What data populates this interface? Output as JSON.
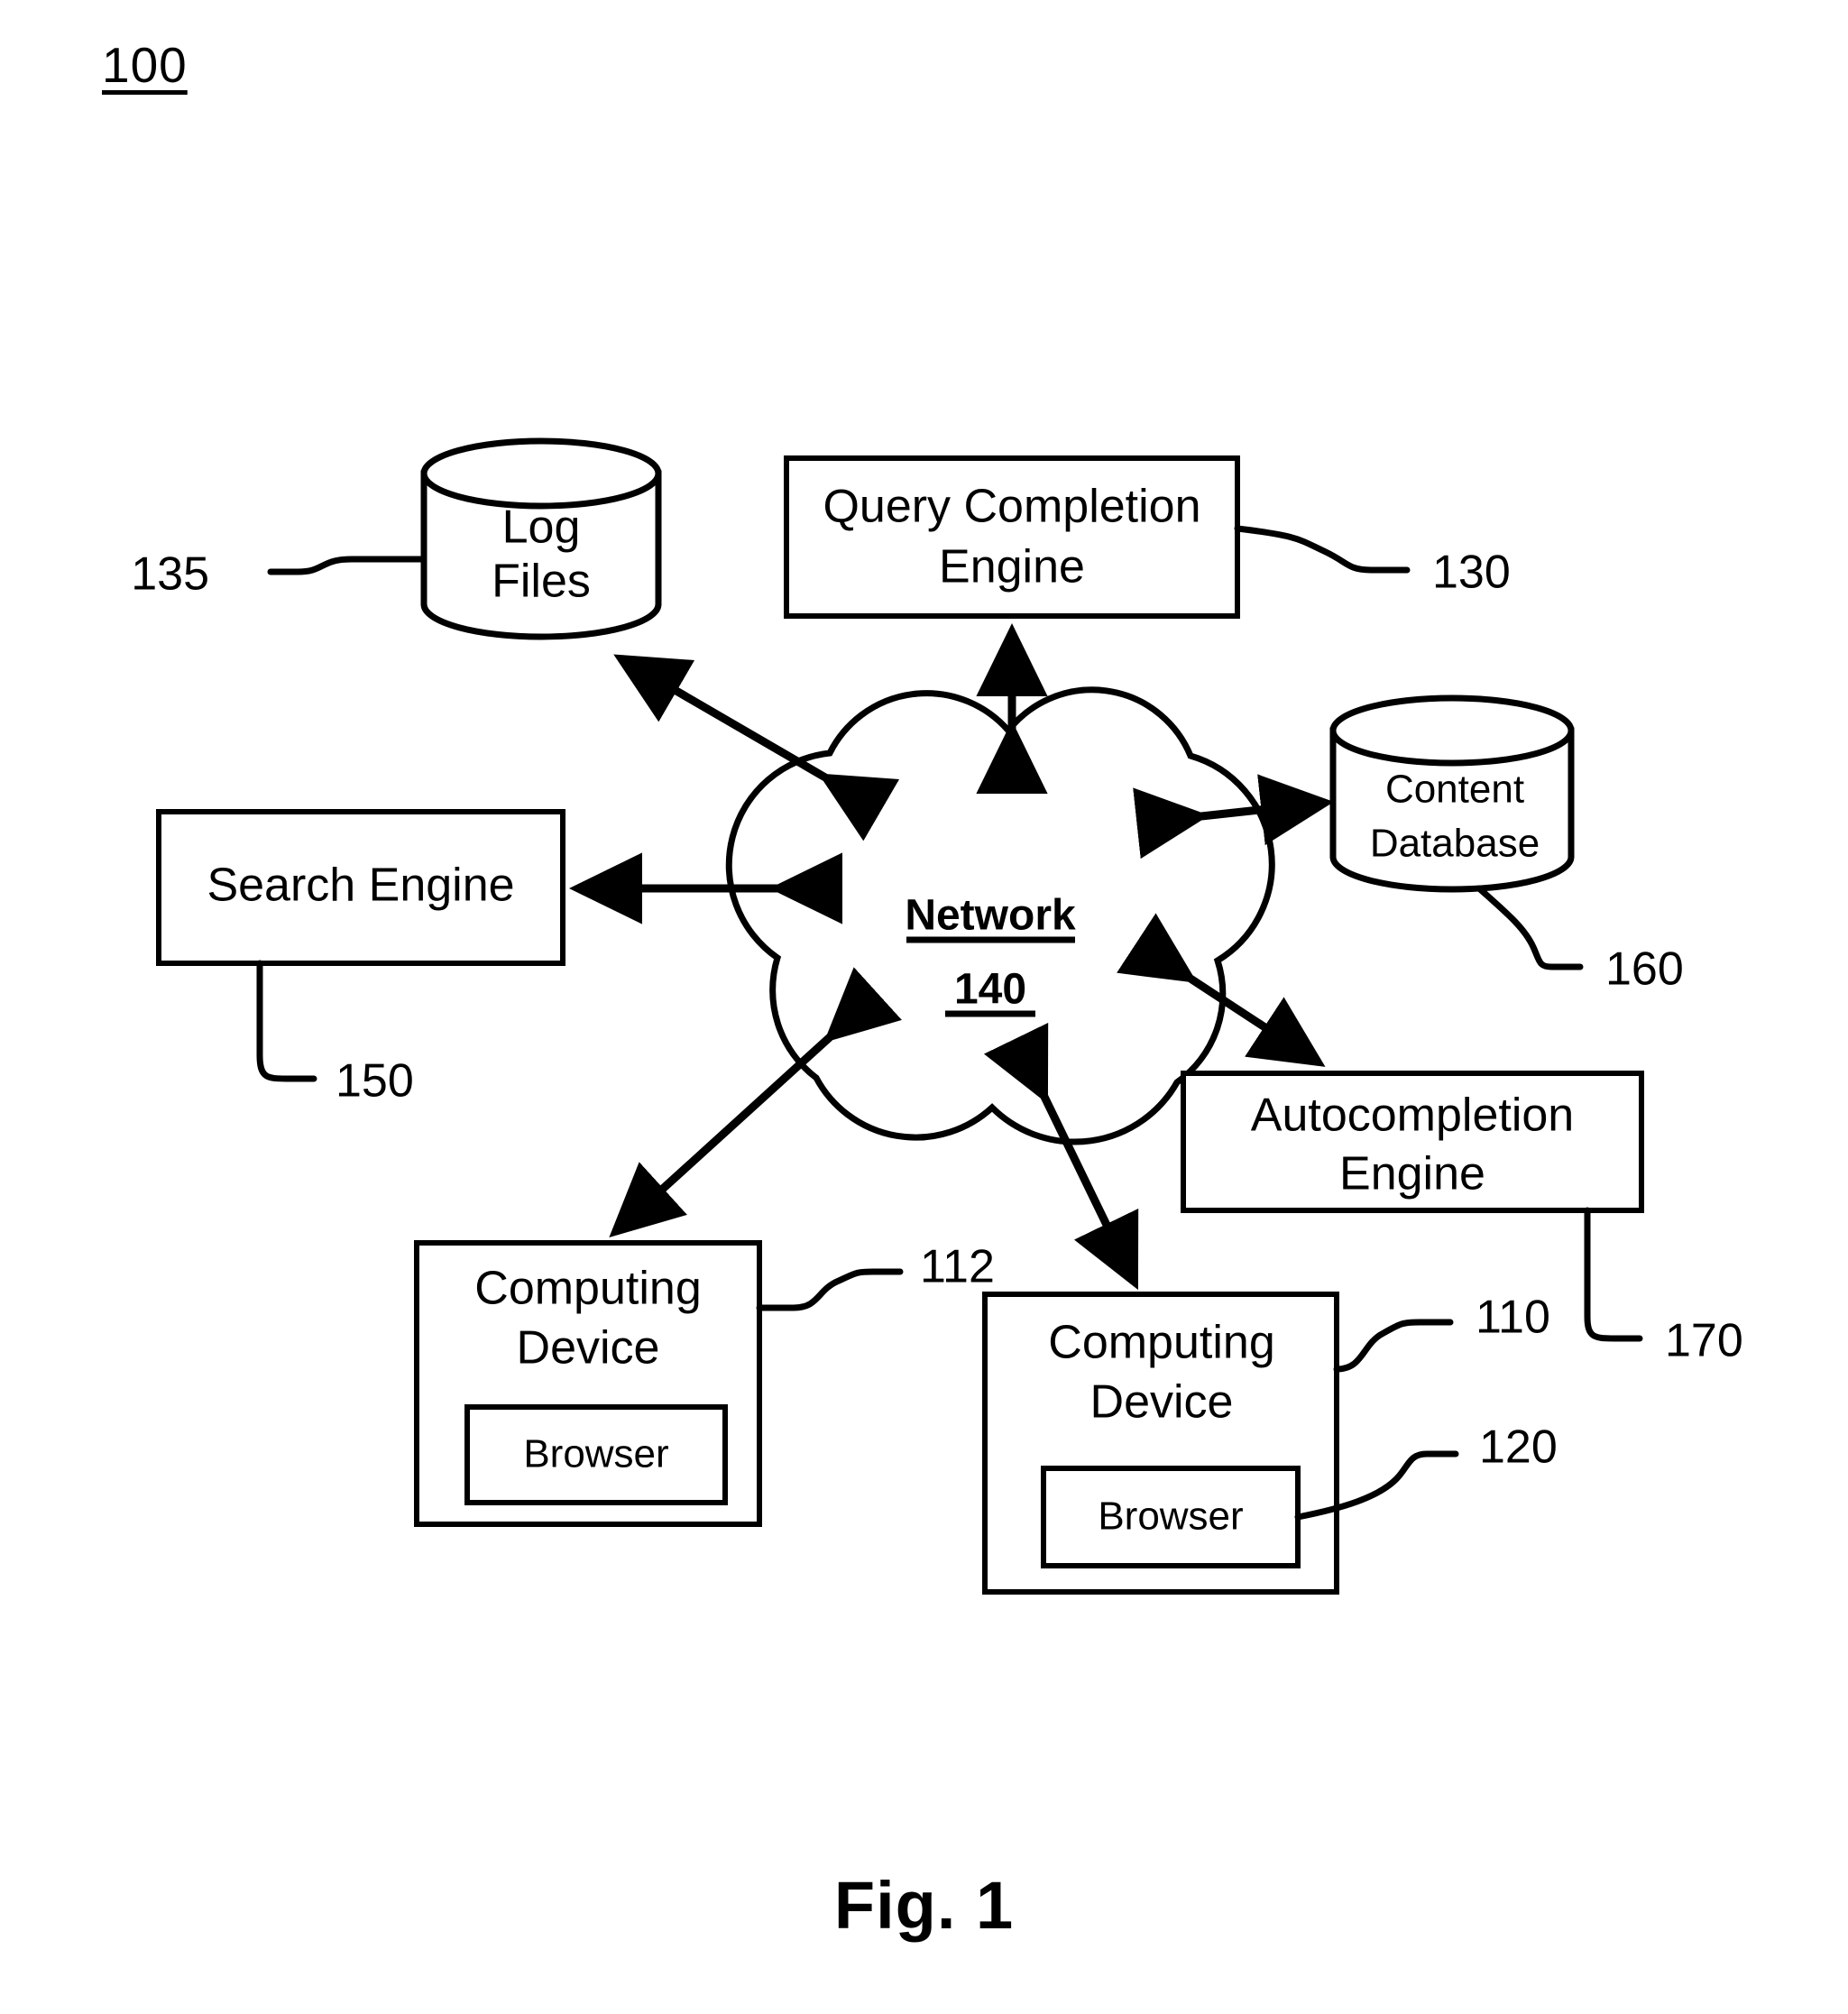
{
  "figure": {
    "figure_number_label": "100",
    "caption": "Fig. 1"
  },
  "nodes": {
    "log_files": {
      "label_line1": "Log",
      "label_line2": "Files",
      "ref": "135",
      "shape": "cylinder"
    },
    "query_completion_engine": {
      "label_line1": "Query Completion",
      "label_line2": "Engine",
      "ref": "130",
      "shape": "rectangle"
    },
    "content_database": {
      "label_line1": "Content",
      "label_line2": "Database",
      "ref": "160",
      "shape": "cylinder"
    },
    "search_engine": {
      "label_line1": "Search Engine",
      "ref": "150",
      "shape": "rectangle"
    },
    "network": {
      "label": "Network",
      "ref": "140",
      "shape": "cloud"
    },
    "autocompletion_engine": {
      "label_line1": "Autocompletion",
      "label_line2": "Engine",
      "ref": "170",
      "shape": "rectangle"
    },
    "computing_device_left": {
      "label_line1": "Computing",
      "label_line2": "Device",
      "ref": "112",
      "shape": "rectangle",
      "browser": {
        "label": "Browser"
      }
    },
    "computing_device_right": {
      "label_line1": "Computing",
      "label_line2": "Device",
      "ref": "110",
      "shape": "rectangle",
      "browser": {
        "label": "Browser",
        "ref": "120"
      }
    }
  },
  "connections": [
    {
      "from": "network",
      "to": "log_files",
      "arrows": "both"
    },
    {
      "from": "network",
      "to": "query_completion_engine",
      "arrows": "both"
    },
    {
      "from": "network",
      "to": "content_database",
      "arrows": "both"
    },
    {
      "from": "network",
      "to": "search_engine",
      "arrows": "both"
    },
    {
      "from": "network",
      "to": "autocompletion_engine",
      "arrows": "both"
    },
    {
      "from": "network",
      "to": "computing_device_left",
      "arrows": "both"
    },
    {
      "from": "network",
      "to": "computing_device_right",
      "arrows": "both"
    }
  ],
  "colors": {
    "ink": "#000000",
    "paper": "#ffffff"
  }
}
